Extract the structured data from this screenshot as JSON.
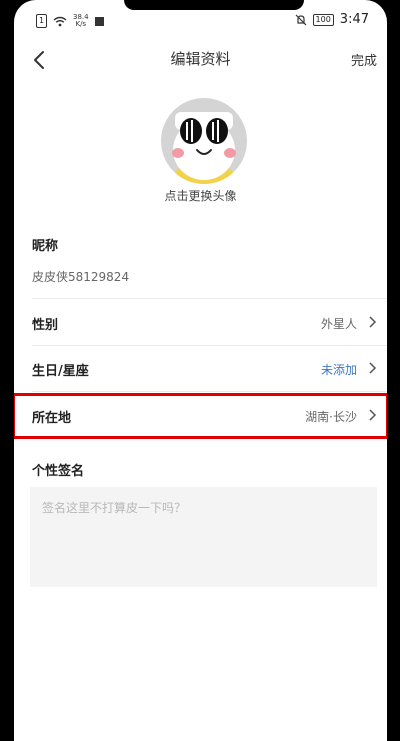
{
  "status_bar": {
    "network_speed": "38.4",
    "speed_unit": "K/s",
    "battery": "100",
    "time": "3:47"
  },
  "header": {
    "title": "编辑资料",
    "done_label": "完成"
  },
  "avatar": {
    "caption": "点击更换头像"
  },
  "nickname": {
    "label": "昵称",
    "value": "皮皮侠58129824"
  },
  "rows": [
    {
      "label": "性别",
      "value": "外星人"
    },
    {
      "label": "生日/星座",
      "value": "未添加"
    },
    {
      "label": "所在地",
      "value": "湖南·长沙"
    }
  ],
  "signature": {
    "label": "个性签名",
    "placeholder": "签名这里不打算皮一下吗？"
  },
  "colors": {
    "highlight": "#e10000",
    "link_blue": "#3a78c2"
  }
}
